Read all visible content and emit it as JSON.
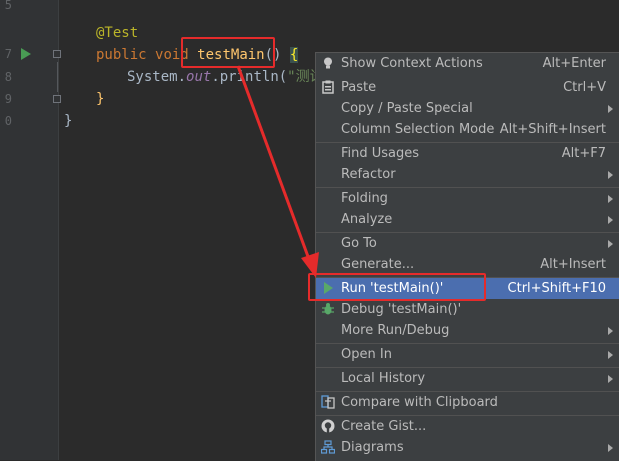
{
  "editor": {
    "line_numbers": [
      "5",
      "7",
      "8",
      "9",
      "0"
    ],
    "annotation": "@Test",
    "kw_public": "public",
    "kw_void": "void",
    "method_name": "testMain",
    "parens": "()",
    "open_brace": "{",
    "print_prefix": "System.",
    "print_field": "out",
    "print_method": ".println(",
    "print_string": "\"测试",
    "close_brace_inner": "}",
    "close_brace_outer": "}"
  },
  "menu": {
    "items": [
      {
        "label": "Show Context Actions",
        "shortcut": "Alt+Enter",
        "icon": "lightbulb-icon"
      },
      {
        "label": "Paste",
        "shortcut": "Ctrl+V",
        "icon": "clipboard-icon"
      },
      {
        "label": "Copy / Paste Special",
        "shortcut": "",
        "submenu": true
      },
      {
        "label": "Column Selection Mode",
        "shortcut": "Alt+Shift+Insert"
      },
      {
        "label": "Find Usages",
        "shortcut": "Alt+F7"
      },
      {
        "label": "Refactor",
        "shortcut": "",
        "submenu": true
      },
      {
        "label": "Folding",
        "shortcut": "",
        "submenu": true
      },
      {
        "label": "Analyze",
        "shortcut": "",
        "submenu": true
      },
      {
        "label": "Go To",
        "shortcut": "",
        "submenu": true
      },
      {
        "label": "Generate...",
        "shortcut": "Alt+Insert"
      },
      {
        "label": "Run 'testMain()'",
        "shortcut": "Ctrl+Shift+F10",
        "icon": "run-icon",
        "highlighted": true
      },
      {
        "label": "Debug 'testMain()'",
        "shortcut": "",
        "icon": "debug-bug-icon"
      },
      {
        "label": "More Run/Debug",
        "shortcut": "",
        "submenu": true
      },
      {
        "label": "Open In",
        "shortcut": "",
        "submenu": true
      },
      {
        "label": "Local History",
        "shortcut": "",
        "submenu": true
      },
      {
        "label": "Compare with Clipboard",
        "shortcut": "",
        "icon": "compare-icon"
      },
      {
        "label": "Create Gist...",
        "shortcut": "",
        "icon": "github-icon"
      },
      {
        "label": "Diagrams",
        "shortcut": "",
        "icon": "diagram-icon",
        "submenu": true
      }
    ]
  },
  "colors": {
    "highlight": "#4b6eaf",
    "annotation_red": "#e52b2b",
    "run_green": "#499c54"
  }
}
